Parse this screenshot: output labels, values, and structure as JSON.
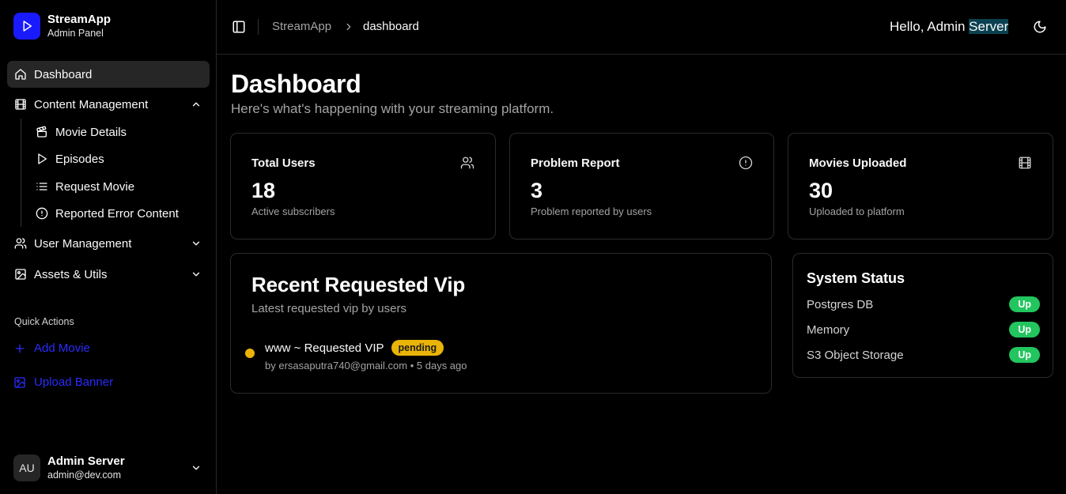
{
  "brand": {
    "name": "StreamApp",
    "subtitle": "Admin Panel"
  },
  "sidebar": {
    "items": [
      {
        "label": "Dashboard",
        "icon": "home-icon",
        "active": true
      },
      {
        "label": "Content Management",
        "icon": "film-icon",
        "expanded": true
      },
      {
        "label": "User Management",
        "icon": "users-icon",
        "expanded": false
      },
      {
        "label": "Assets & Utils",
        "icon": "image-icon",
        "expanded": false
      }
    ],
    "sub_items": [
      {
        "label": "Movie Details",
        "icon": "clapperboard-icon"
      },
      {
        "label": "Episodes",
        "icon": "play-icon"
      },
      {
        "label": "Request Movie",
        "icon": "list-icon"
      },
      {
        "label": "Reported Error Content",
        "icon": "alert-circle-icon"
      }
    ],
    "quick_actions_title": "Quick Actions",
    "quick_actions": [
      {
        "label": "Add Movie",
        "icon": "plus-icon"
      },
      {
        "label": "Upload Banner",
        "icon": "image-icon"
      }
    ],
    "user": {
      "initials": "AU",
      "name": "Admin Server",
      "email": "admin@dev.com"
    }
  },
  "header": {
    "breadcrumb": [
      "StreamApp",
      "dashboard"
    ],
    "greeting_prefix": "Hello, Admin ",
    "greeting_highlight": "Server"
  },
  "main": {
    "title": "Dashboard",
    "subtitle": "Here's what's happening with your streaming platform.",
    "stats": [
      {
        "title": "Total Users",
        "value": "18",
        "sub": "Active subscribers",
        "icon": "users-icon"
      },
      {
        "title": "Problem Report",
        "value": "3",
        "sub": "Problem reported by users",
        "icon": "alert-circle-icon"
      },
      {
        "title": "Movies Uploaded",
        "value": "30",
        "sub": "Uploaded to platform",
        "icon": "film-icon"
      }
    ],
    "recent": {
      "title": "Recent Requested Vip",
      "subtitle": "Latest requested vip by users",
      "items": [
        {
          "name": "www ~ Requested VIP",
          "status": "pending",
          "meta": "by ersasaputra740@gmail.com • 5 days ago",
          "status_color": "#eab308"
        }
      ]
    },
    "system": {
      "title": "System Status",
      "services": [
        {
          "name": "Postgres DB",
          "status": "Up"
        },
        {
          "name": "Memory",
          "status": "Up"
        },
        {
          "name": "S3 Object Storage",
          "status": "Up"
        }
      ],
      "up_color": "#22c55e"
    }
  }
}
